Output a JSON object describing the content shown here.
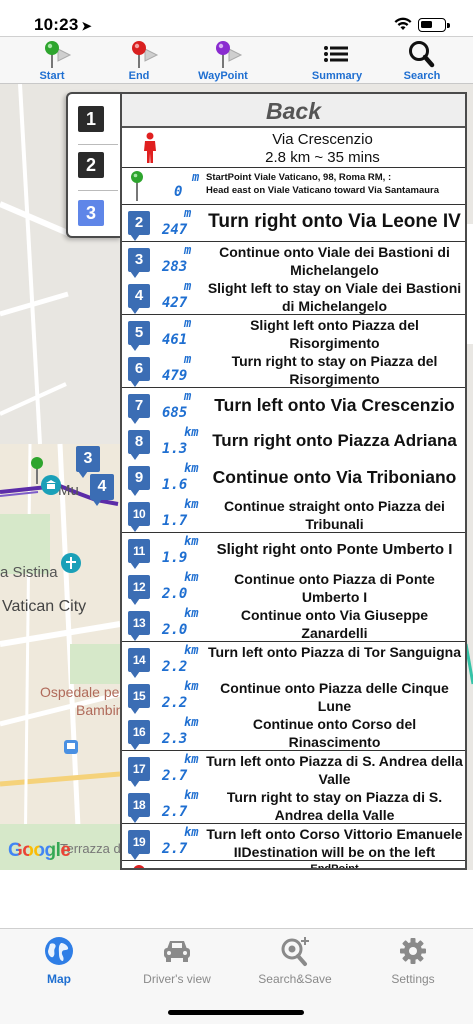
{
  "status": {
    "time": "10:23",
    "location_glyph": "➤"
  },
  "toolbar": {
    "start": "Start",
    "end": "End",
    "waypoint": "WayPoint",
    "summary": "Summary",
    "search": "Search"
  },
  "map": {
    "labels": {
      "vatican": "Vatican City",
      "sistina": "a Sistina",
      "ospedale": "Ospedale pe",
      "bambin": "Bambin",
      "mu": "Mu",
      "terrazza": "Terrazza del Gia"
    },
    "logo": "Google",
    "markers": {
      "m3": "3",
      "m4": "4"
    }
  },
  "pager": {
    "p1": "1",
    "p2": "2",
    "p3": "3"
  },
  "panel": {
    "back_label": "Back",
    "summary_street": "Via Crescenzio",
    "summary_stats": "2.8 km  ~ 35 mins",
    "start_dist": "0",
    "start_unit": "m",
    "start_line1": "StartPoint Viale Vaticano, 98,  Roma RM, :",
    "start_line2": "Head east on Viale Vaticano toward Via Santamaura",
    "steps": [
      {
        "num": "2",
        "dist": "247",
        "unit": "m",
        "text": "Turn right onto Via Leone IV"
      },
      {
        "num": "3",
        "dist": "283",
        "unit": "m",
        "text": "Continue onto Viale dei Bastioni di Michelangelo"
      },
      {
        "num": "4",
        "dist": "427",
        "unit": "m",
        "text": "Slight left to stay on Viale dei Bastioni di Michelangelo"
      },
      {
        "num": "5",
        "dist": "461",
        "unit": "m",
        "text": "Slight left onto Piazza del Risorgimento"
      },
      {
        "num": "6",
        "dist": "479",
        "unit": "m",
        "text": "Turn right to stay on Piazza del Risorgimento"
      },
      {
        "num": "7",
        "dist": "685",
        "unit": "m",
        "text": "Turn left onto Via Crescenzio"
      },
      {
        "num": "8",
        "dist": "1.3",
        "unit": "km",
        "text": "Turn right onto Piazza Adriana"
      },
      {
        "num": "9",
        "dist": "1.6",
        "unit": "km",
        "text": "Continue onto Via Triboniano"
      },
      {
        "num": "10",
        "dist": "1.7",
        "unit": "km",
        "text": "Continue straight onto Piazza dei Tribunali"
      },
      {
        "num": "11",
        "dist": "1.9",
        "unit": "km",
        "text": "Slight right onto Ponte Umberto I"
      },
      {
        "num": "12",
        "dist": "2.0",
        "unit": "km",
        "text": "Continue onto Piazza di Ponte Umberto I"
      },
      {
        "num": "13",
        "dist": "2.0",
        "unit": "km",
        "text": "Continue onto Via Giuseppe Zanardelli"
      },
      {
        "num": "14",
        "dist": "2.2",
        "unit": "km",
        "text": "Turn left onto Piazza di Tor Sanguigna"
      },
      {
        "num": "15",
        "dist": "2.2",
        "unit": "km",
        "text": "Continue onto Piazza delle Cinque Lune"
      },
      {
        "num": "16",
        "dist": "2.3",
        "unit": "km",
        "text": "Continue onto Corso del Rinascimento"
      },
      {
        "num": "17",
        "dist": "2.7",
        "unit": "km",
        "text": "Turn left onto Piazza di S. Andrea della Valle"
      },
      {
        "num": "18",
        "dist": "2.7",
        "unit": "km",
        "text": "Turn right to stay on Piazza di S. Andrea della Valle"
      },
      {
        "num": "19",
        "dist": "2.7",
        "unit": "km",
        "text": "Turn left onto Corso Vittorio Emanuele IIDestination will be on the left"
      }
    ],
    "end_label": "EndPoint"
  },
  "tabbar": {
    "map": "Map",
    "drivers_view": "Driver's view",
    "search_save": "Search&Save",
    "settings": "Settings"
  },
  "colors": {
    "accent": "#1f6fd1",
    "step_badge": "#3b6db4",
    "pager_active": "#5f86e8",
    "pager_inactive": "#2b2b2b",
    "route": "#5b2ca8"
  }
}
